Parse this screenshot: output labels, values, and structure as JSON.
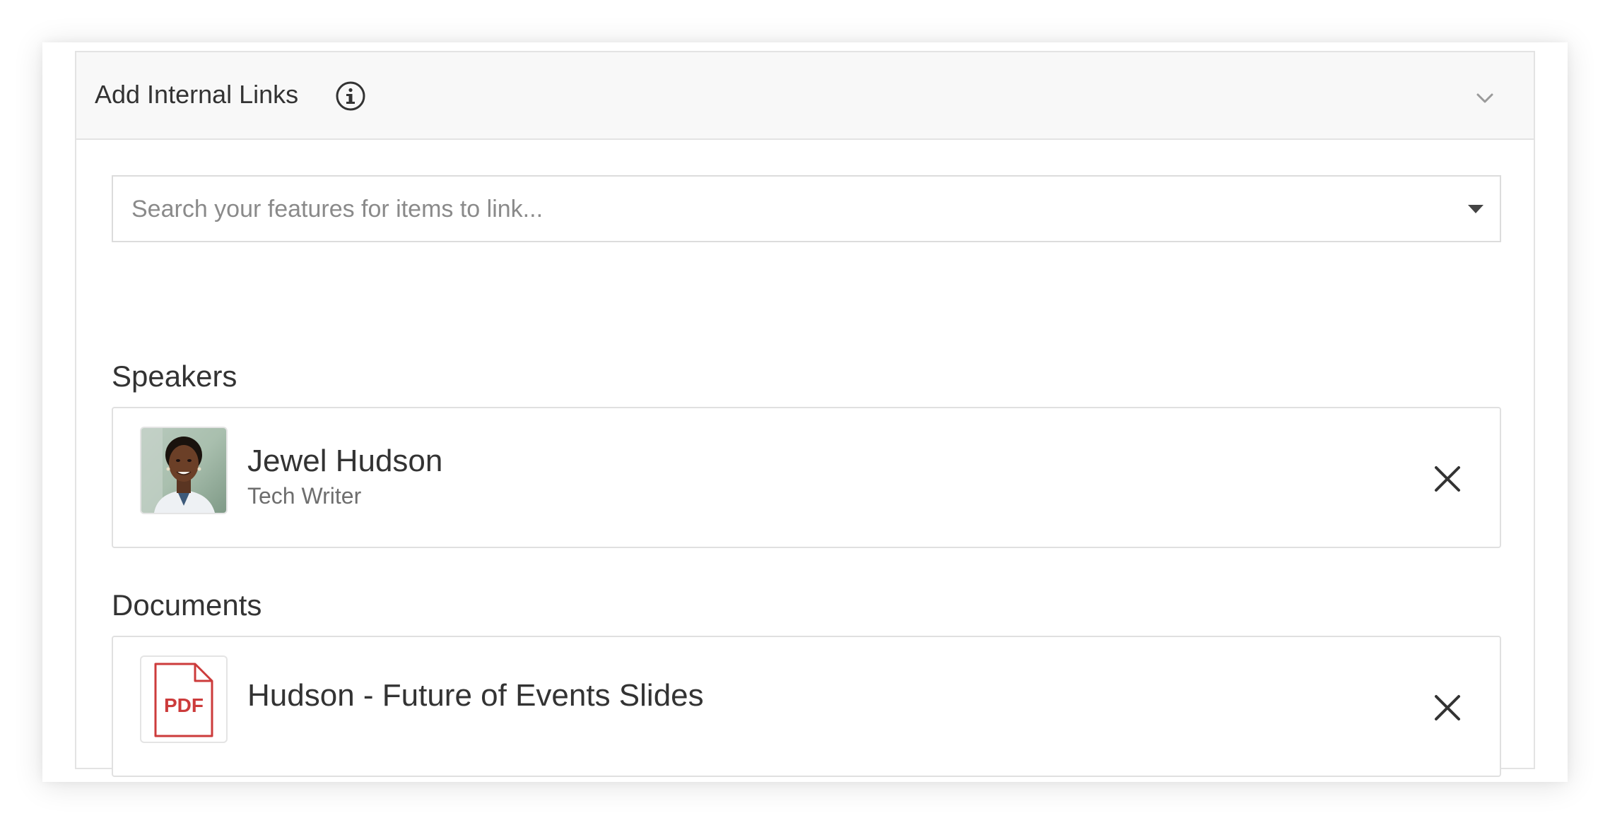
{
  "panel": {
    "title": "Add Internal Links",
    "info_icon": "info-icon",
    "collapse_icon": "chevron-down-icon"
  },
  "search": {
    "placeholder": "Search your features for items to link...",
    "dropdown_icon": "caret-down-icon"
  },
  "speakers": {
    "heading": "Speakers",
    "items": [
      {
        "name": "Jewel Hudson",
        "role": "Tech Writer",
        "remove_icon": "close-icon"
      }
    ]
  },
  "documents": {
    "heading": "Documents",
    "items": [
      {
        "title": "Hudson - Future of Events Slides",
        "file_badge": "PDF",
        "remove_icon": "close-icon"
      }
    ]
  },
  "colors": {
    "pdf_red": "#cc3b3b",
    "header_bg": "#f8f8f8",
    "border": "#e3e3e3",
    "text_primary": "#333333",
    "text_secondary": "#6e6e6e",
    "placeholder": "#8a8a8a"
  }
}
